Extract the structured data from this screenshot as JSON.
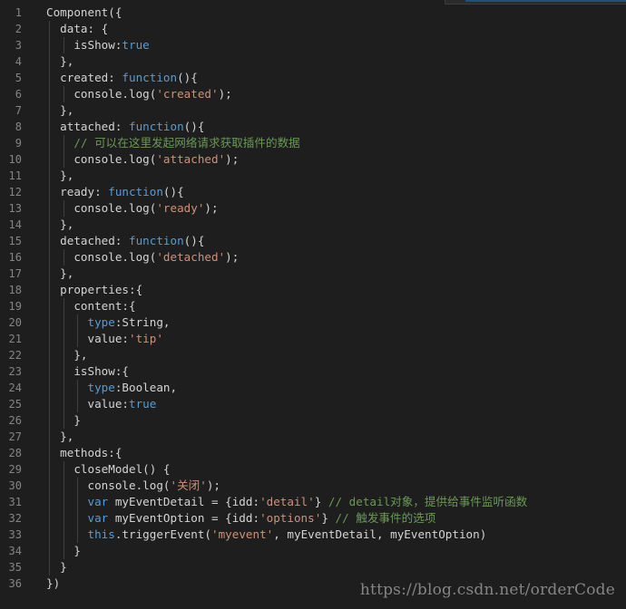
{
  "editor": {
    "colors": {
      "background": "#1e1e1e",
      "line_number": "#858585",
      "plain": "#d4d4d4",
      "keyword": "#569cd6",
      "string": "#ce9178",
      "comment": "#6a9955"
    },
    "lines": [
      {
        "no": "1",
        "tokens": [
          {
            "t": "Component({",
            "c": "pl"
          }
        ]
      },
      {
        "no": "2",
        "tokens": [
          {
            "t": "  data: {",
            "c": "pl"
          }
        ]
      },
      {
        "no": "3",
        "tokens": [
          {
            "t": "    isShow:",
            "c": "pl"
          },
          {
            "t": "true",
            "c": "kw"
          }
        ]
      },
      {
        "no": "4",
        "tokens": [
          {
            "t": "  },",
            "c": "pl"
          }
        ]
      },
      {
        "no": "5",
        "tokens": [
          {
            "t": "  created: ",
            "c": "pl"
          },
          {
            "t": "function",
            "c": "kw"
          },
          {
            "t": "(){",
            "c": "pl"
          }
        ]
      },
      {
        "no": "6",
        "tokens": [
          {
            "t": "    console.log(",
            "c": "pl"
          },
          {
            "t": "'created'",
            "c": "str"
          },
          {
            "t": ");",
            "c": "pl"
          }
        ]
      },
      {
        "no": "7",
        "tokens": [
          {
            "t": "  },",
            "c": "pl"
          }
        ]
      },
      {
        "no": "8",
        "tokens": [
          {
            "t": "  attached: ",
            "c": "pl"
          },
          {
            "t": "function",
            "c": "kw"
          },
          {
            "t": "(){",
            "c": "pl"
          }
        ]
      },
      {
        "no": "9",
        "tokens": [
          {
            "t": "    // 可以在这里发起网络请求获取插件的数据",
            "c": "cmt"
          }
        ]
      },
      {
        "no": "10",
        "tokens": [
          {
            "t": "    console.log(",
            "c": "pl"
          },
          {
            "t": "'attached'",
            "c": "str"
          },
          {
            "t": ");",
            "c": "pl"
          }
        ]
      },
      {
        "no": "11",
        "tokens": [
          {
            "t": "  },",
            "c": "pl"
          }
        ]
      },
      {
        "no": "12",
        "tokens": [
          {
            "t": "  ready: ",
            "c": "pl"
          },
          {
            "t": "function",
            "c": "kw"
          },
          {
            "t": "(){",
            "c": "pl"
          }
        ]
      },
      {
        "no": "13",
        "tokens": [
          {
            "t": "    console.log(",
            "c": "pl"
          },
          {
            "t": "'ready'",
            "c": "str"
          },
          {
            "t": ");",
            "c": "pl"
          }
        ]
      },
      {
        "no": "14",
        "tokens": [
          {
            "t": "  },",
            "c": "pl"
          }
        ]
      },
      {
        "no": "15",
        "tokens": [
          {
            "t": "  detached: ",
            "c": "pl"
          },
          {
            "t": "function",
            "c": "kw"
          },
          {
            "t": "(){",
            "c": "pl"
          }
        ]
      },
      {
        "no": "16",
        "tokens": [
          {
            "t": "    console.log(",
            "c": "pl"
          },
          {
            "t": "'detached'",
            "c": "str"
          },
          {
            "t": ");",
            "c": "pl"
          }
        ]
      },
      {
        "no": "17",
        "tokens": [
          {
            "t": "  },",
            "c": "pl"
          }
        ]
      },
      {
        "no": "18",
        "tokens": [
          {
            "t": "  properties:{",
            "c": "pl"
          }
        ]
      },
      {
        "no": "19",
        "tokens": [
          {
            "t": "    content:{",
            "c": "pl"
          }
        ]
      },
      {
        "no": "20",
        "tokens": [
          {
            "t": "      ",
            "c": "pl"
          },
          {
            "t": "type",
            "c": "kw"
          },
          {
            "t": ":String,",
            "c": "pl"
          }
        ]
      },
      {
        "no": "21",
        "tokens": [
          {
            "t": "      value:",
            "c": "pl"
          },
          {
            "t": "'tip'",
            "c": "str"
          }
        ]
      },
      {
        "no": "22",
        "tokens": [
          {
            "t": "    },",
            "c": "pl"
          }
        ]
      },
      {
        "no": "23",
        "tokens": [
          {
            "t": "    isShow:{",
            "c": "pl"
          }
        ]
      },
      {
        "no": "24",
        "tokens": [
          {
            "t": "      ",
            "c": "pl"
          },
          {
            "t": "type",
            "c": "kw"
          },
          {
            "t": ":Boolean,",
            "c": "pl"
          }
        ]
      },
      {
        "no": "25",
        "tokens": [
          {
            "t": "      value:",
            "c": "pl"
          },
          {
            "t": "true",
            "c": "kw"
          }
        ]
      },
      {
        "no": "26",
        "tokens": [
          {
            "t": "    }",
            "c": "pl"
          }
        ]
      },
      {
        "no": "27",
        "tokens": [
          {
            "t": "  },",
            "c": "pl"
          }
        ]
      },
      {
        "no": "28",
        "tokens": [
          {
            "t": "  methods:{",
            "c": "pl"
          }
        ]
      },
      {
        "no": "29",
        "tokens": [
          {
            "t": "    closeModel() {",
            "c": "pl"
          }
        ]
      },
      {
        "no": "30",
        "tokens": [
          {
            "t": "      console.log(",
            "c": "pl"
          },
          {
            "t": "'关闭'",
            "c": "str"
          },
          {
            "t": ");",
            "c": "pl"
          }
        ]
      },
      {
        "no": "31",
        "tokens": [
          {
            "t": "      ",
            "c": "pl"
          },
          {
            "t": "var",
            "c": "kw"
          },
          {
            "t": " myEventDetail = {idd:",
            "c": "pl"
          },
          {
            "t": "'detail'",
            "c": "str"
          },
          {
            "t": "} ",
            "c": "pl"
          },
          {
            "t": "// detail对象，提供给事件监听函数",
            "c": "cmt"
          }
        ]
      },
      {
        "no": "32",
        "tokens": [
          {
            "t": "      ",
            "c": "pl"
          },
          {
            "t": "var",
            "c": "kw"
          },
          {
            "t": " myEventOption = {idd:",
            "c": "pl"
          },
          {
            "t": "'options'",
            "c": "str"
          },
          {
            "t": "} ",
            "c": "pl"
          },
          {
            "t": "// 触发事件的选项",
            "c": "cmt"
          }
        ]
      },
      {
        "no": "33",
        "tokens": [
          {
            "t": "      ",
            "c": "pl"
          },
          {
            "t": "this",
            "c": "kw"
          },
          {
            "t": ".triggerEvent(",
            "c": "pl"
          },
          {
            "t": "'myevent'",
            "c": "str"
          },
          {
            "t": ", myEventDetail, myEventOption)",
            "c": "pl"
          }
        ]
      },
      {
        "no": "34",
        "tokens": [
          {
            "t": "    }",
            "c": "pl"
          }
        ]
      },
      {
        "no": "35",
        "tokens": [
          {
            "t": "  }",
            "c": "pl"
          }
        ]
      },
      {
        "no": "36",
        "tokens": [
          {
            "t": "})",
            "c": "pl"
          }
        ]
      }
    ]
  },
  "watermark": {
    "text": "https://blog.csdn.net/orderCode"
  }
}
